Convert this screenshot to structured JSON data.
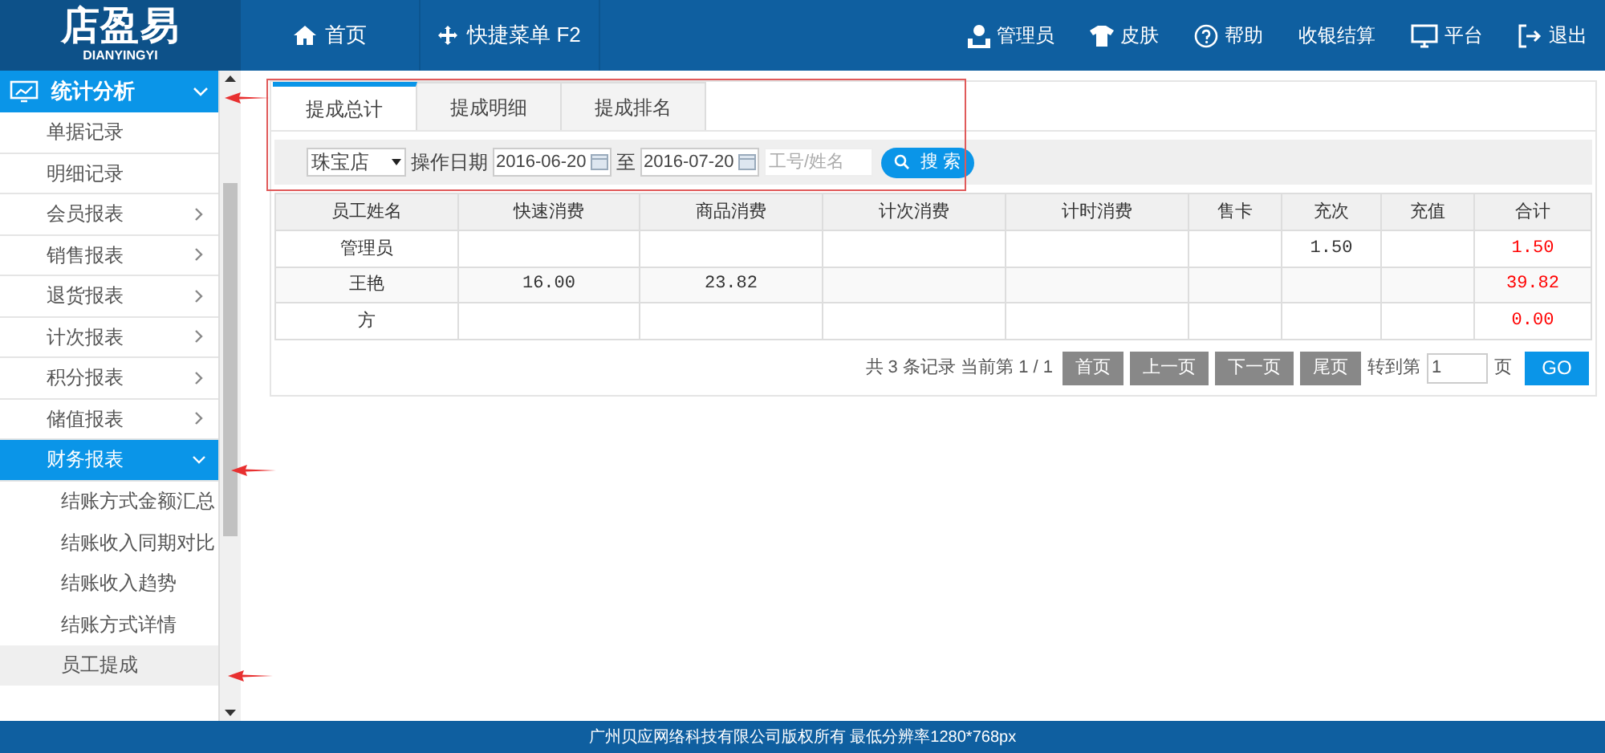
{
  "header": {
    "logo": "店盈易",
    "logo_sub": "DIANYINGYI",
    "nav": [
      {
        "label": "首页"
      },
      {
        "label": "快捷菜单 F2"
      }
    ],
    "actions": [
      {
        "label": "管理员"
      },
      {
        "label": "皮肤"
      },
      {
        "label": "帮助"
      },
      {
        "label": "收银结算"
      },
      {
        "label": "平台"
      },
      {
        "label": "退出"
      }
    ]
  },
  "sidebar": {
    "section": {
      "label": "统计分析",
      "expanded": true
    },
    "items": [
      {
        "label": "单据记录",
        "has_arrow": false,
        "expanded": false
      },
      {
        "label": "明细记录",
        "has_arrow": false,
        "expanded": false
      },
      {
        "label": "会员报表",
        "has_arrow": true,
        "expanded": false
      },
      {
        "label": "销售报表",
        "has_arrow": true,
        "expanded": false
      },
      {
        "label": "退货报表",
        "has_arrow": true,
        "expanded": false
      },
      {
        "label": "计次报表",
        "has_arrow": true,
        "expanded": false
      },
      {
        "label": "积分报表",
        "has_arrow": true,
        "expanded": false
      },
      {
        "label": "储值报表",
        "has_arrow": true,
        "expanded": false
      },
      {
        "label": "财务报表",
        "has_arrow": true,
        "expanded": true,
        "children": [
          {
            "label": "结账方式金额汇总",
            "selected": false
          },
          {
            "label": "结账收入同期对比",
            "selected": false
          },
          {
            "label": "结账收入趋势",
            "selected": false
          },
          {
            "label": "结账方式详情",
            "selected": false
          },
          {
            "label": "员工提成",
            "selected": true
          }
        ]
      }
    ]
  },
  "tabs": [
    {
      "label": "提成总计",
      "selected": true
    },
    {
      "label": "提成明细",
      "selected": false
    },
    {
      "label": "提成排名",
      "selected": false
    }
  ],
  "filter": {
    "store": "珠宝店",
    "date_label": "操作日期",
    "date_from": "2016-06-20",
    "to_label": "至",
    "date_to": "2016-07-20",
    "placeholder": "工号/姓名",
    "search_button": "搜 索"
  },
  "table": {
    "columns": [
      "员工姓名",
      "快速消费",
      "商品消费",
      "计次消费",
      "计时消费",
      "售卡",
      "充次",
      "充值",
      "合计"
    ],
    "rows": [
      [
        "管理员",
        "",
        "",
        "",
        "",
        "",
        "1.50",
        "",
        "1.50"
      ],
      [
        "王艳",
        "16.00",
        "23.82",
        "",
        "",
        "",
        "",
        "",
        "39.82"
      ],
      [
        "方",
        "",
        "",
        "",
        "",
        "",
        "",
        "",
        "0.00"
      ]
    ]
  },
  "pagination": {
    "summary": "共 3 条记录 当前第 1 / 1",
    "buttons": [
      "首页",
      "上一页",
      "下一页",
      "尾页"
    ],
    "goto_label": "转到第",
    "page_value": "1",
    "page_unit": "页",
    "go": "GO"
  },
  "footer": "广州贝应网络科技有限公司版权所有 最低分辨率1280*768px"
}
